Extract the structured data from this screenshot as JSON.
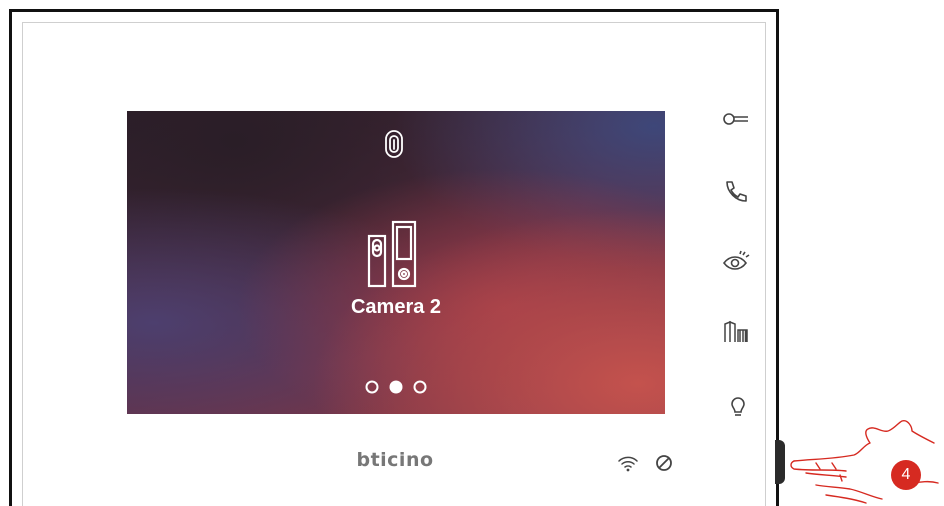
{
  "screen": {
    "camera_label": "Camera 2",
    "pager": {
      "total": 3,
      "active_index": 1
    }
  },
  "brand": {
    "logo_text": "bticino"
  },
  "side_buttons": [
    {
      "name": "key-icon"
    },
    {
      "name": "phone-icon"
    },
    {
      "name": "eye-icon"
    },
    {
      "name": "gate-icon"
    },
    {
      "name": "lightbulb-icon"
    }
  ],
  "status": {
    "wifi": "wifi-icon",
    "dnd": "do-not-disturb-icon"
  },
  "callout": {
    "number": "4"
  },
  "colors": {
    "callout": "#d62a21",
    "screen_accent": "#c4524d",
    "text": "#ffffff"
  }
}
